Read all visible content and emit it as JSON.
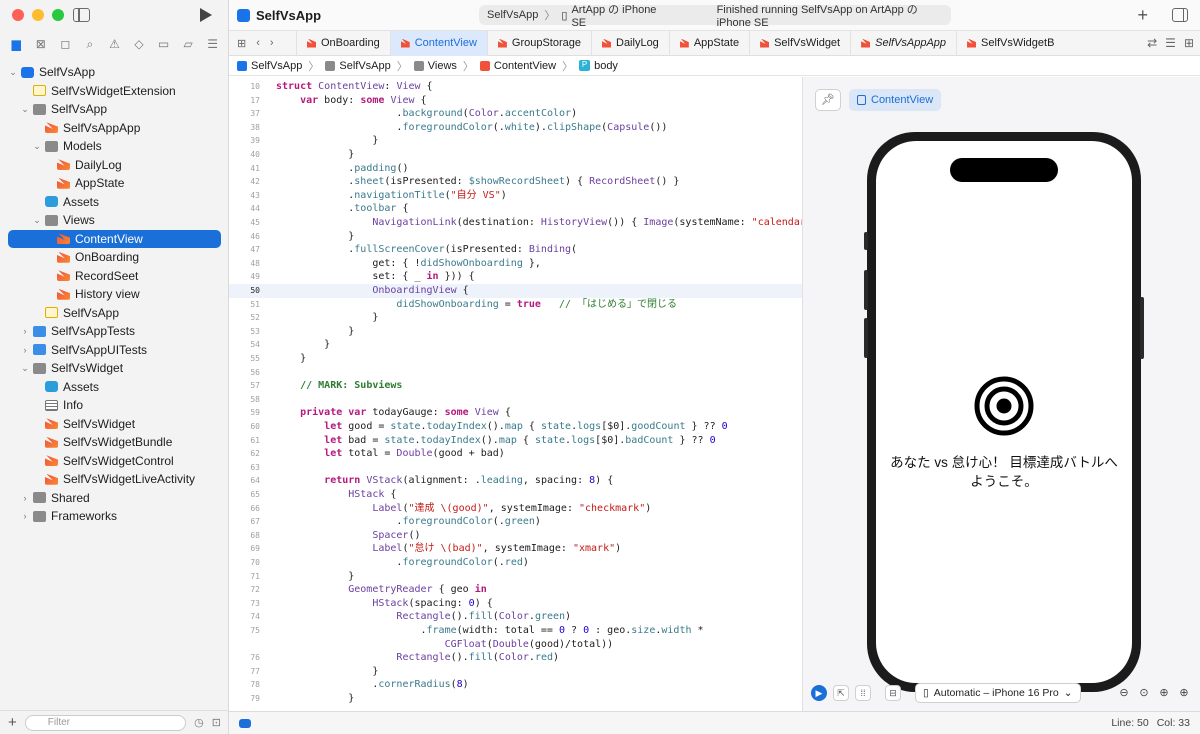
{
  "window": {
    "app_title": "SelfVsApp",
    "scheme": "SelfVsApp",
    "destination": "ArtApp の iPhone SE",
    "status": "Finished running SelfVsApp on ArtApp の iPhone SE"
  },
  "sidebar": {
    "items": [
      {
        "label": "SelfVsApp",
        "depth": 0,
        "icon": "app",
        "chevron": "down"
      },
      {
        "label": "SelfVsWidgetExtension",
        "depth": 1,
        "icon": "ext",
        "chevron": ""
      },
      {
        "label": "SelfVsApp",
        "depth": 1,
        "icon": "folder",
        "chevron": "down"
      },
      {
        "label": "SelfVsAppApp",
        "depth": 2,
        "icon": "swift",
        "chevron": ""
      },
      {
        "label": "Models",
        "depth": 2,
        "icon": "folder",
        "chevron": "down"
      },
      {
        "label": "DailyLog",
        "depth": 3,
        "icon": "swift",
        "chevron": ""
      },
      {
        "label": "AppState",
        "depth": 3,
        "icon": "swift",
        "chevron": ""
      },
      {
        "label": "Assets",
        "depth": 2,
        "icon": "assets",
        "chevron": ""
      },
      {
        "label": "Views",
        "depth": 2,
        "icon": "folder",
        "chevron": "down"
      },
      {
        "label": "ContentView",
        "depth": 3,
        "icon": "swift",
        "chevron": "",
        "selected": true
      },
      {
        "label": "OnBoarding",
        "depth": 3,
        "icon": "swift",
        "chevron": ""
      },
      {
        "label": "RecordSeet",
        "depth": 3,
        "icon": "swift",
        "chevron": ""
      },
      {
        "label": "History view",
        "depth": 3,
        "icon": "swift",
        "chevron": ""
      },
      {
        "label": "SelfVsApp",
        "depth": 2,
        "icon": "ext",
        "chevron": ""
      },
      {
        "label": "SelfVsAppTests",
        "depth": 1,
        "icon": "folder-blue",
        "chevron": "right"
      },
      {
        "label": "SelfVsAppUITests",
        "depth": 1,
        "icon": "folder-blue",
        "chevron": "right"
      },
      {
        "label": "SelfVsWidget",
        "depth": 1,
        "icon": "folder",
        "chevron": "down"
      },
      {
        "label": "Assets",
        "depth": 2,
        "icon": "assets",
        "chevron": ""
      },
      {
        "label": "Info",
        "depth": 2,
        "icon": "plist",
        "chevron": ""
      },
      {
        "label": "SelfVsWidget",
        "depth": 2,
        "icon": "swift",
        "chevron": ""
      },
      {
        "label": "SelfVsWidgetBundle",
        "depth": 2,
        "icon": "swift",
        "chevron": ""
      },
      {
        "label": "SelfVsWidgetControl",
        "depth": 2,
        "icon": "swift",
        "chevron": ""
      },
      {
        "label": "SelfVsWidgetLiveActivity",
        "depth": 2,
        "icon": "swift",
        "chevron": ""
      },
      {
        "label": "Shared",
        "depth": 1,
        "icon": "folder",
        "chevron": "right"
      },
      {
        "label": "Frameworks",
        "depth": 1,
        "icon": "folder",
        "chevron": "right"
      }
    ],
    "filter_placeholder": "Filter"
  },
  "tabs": [
    {
      "label": "OnBoarding",
      "active": false,
      "italic": false
    },
    {
      "label": "ContentView",
      "active": true,
      "italic": false
    },
    {
      "label": "GroupStorage",
      "active": false,
      "italic": false
    },
    {
      "label": "DailyLog",
      "active": false,
      "italic": false
    },
    {
      "label": "AppState",
      "active": false,
      "italic": false
    },
    {
      "label": "SelfVsWidget",
      "active": false,
      "italic": false
    },
    {
      "label": "SelfVsAppApp",
      "active": false,
      "italic": true
    },
    {
      "label": "SelfVsWidgetB",
      "active": false,
      "italic": false
    }
  ],
  "breadcrumb": [
    "SelfVsApp",
    "SelfVsApp",
    "Views",
    "ContentView",
    "body"
  ],
  "code": {
    "current_line": "50",
    "lines": [
      {
        "n": "10",
        "html": "<span class='kw'>struct</span> <span class='ty'>ContentView</span>: <span class='ty'>View</span> {"
      },
      {
        "n": "17",
        "html": "    <span class='kw'>var</span> body: <span class='kw'>some</span> <span class='ty'>View</span> {"
      },
      {
        "n": "37",
        "html": "                    .<span class='fn'>background</span>(<span class='ty'>Color</span>.<span class='fn'>accentColor</span>)"
      },
      {
        "n": "38",
        "html": "                    .<span class='fn'>foregroundColor</span>(.<span class='fn'>white</span>).<span class='fn'>clipShape</span>(<span class='ty'>Capsule</span>())"
      },
      {
        "n": "39",
        "html": "                }"
      },
      {
        "n": "40",
        "html": "            }"
      },
      {
        "n": "41",
        "html": "            .<span class='fn'>padding</span>()"
      },
      {
        "n": "42",
        "html": "            .<span class='fn'>sheet</span>(isPresented: <span class='fn'>$showRecordSheet</span>) { <span class='ty'>RecordSheet</span>() }"
      },
      {
        "n": "43",
        "html": "            .<span class='fn'>navigationTitle</span>(<span class='str'>\"自分 VS\"</span>)"
      },
      {
        "n": "44",
        "html": "            .<span class='fn'>toolbar</span> {"
      },
      {
        "n": "45",
        "html": "                <span class='ty'>NavigationLink</span>(destination: <span class='ty'>HistoryView</span>()) { <span class='ty'>Image</span>(systemName: <span class='str'>\"calendar\"</span>) }"
      },
      {
        "n": "46",
        "html": "            }"
      },
      {
        "n": "47",
        "html": "            .<span class='fn'>fullScreenCover</span>(isPresented: <span class='ty'>Binding</span>("
      },
      {
        "n": "48",
        "html": "                get: { !<span class='fn'>didShowOnboarding</span> },"
      },
      {
        "n": "49",
        "html": "                set: { _ <span class='kw'>in</span> })) {"
      },
      {
        "n": "50",
        "html": "                <span class='ty'>OnboardingView</span> {"
      },
      {
        "n": "51",
        "html": "                    <span class='fn'>didShowOnboarding</span> = <span class='kw'>true</span>   <span class='cm'>// 「はじめる」で閉じる</span>"
      },
      {
        "n": "52",
        "html": "                }"
      },
      {
        "n": "53",
        "html": "            }"
      },
      {
        "n": "54",
        "html": "        }"
      },
      {
        "n": "55",
        "html": "    }"
      },
      {
        "n": "56",
        "html": ""
      },
      {
        "n": "57",
        "html": "    <span class='mk'>// MARK: Subviews</span>"
      },
      {
        "n": "58",
        "html": ""
      },
      {
        "n": "59",
        "html": "    <span class='kw'>private</span> <span class='kw'>var</span> todayGauge: <span class='kw'>some</span> <span class='ty'>View</span> {"
      },
      {
        "n": "60",
        "html": "        <span class='kw'>let</span> good = <span class='fn'>state</span>.<span class='fn'>todayIndex</span>().<span class='fn'>map</span> { <span class='fn'>state</span>.<span class='fn'>logs</span>[$0].<span class='fn'>goodCount</span> } ?? <span class='num'>0</span>"
      },
      {
        "n": "61",
        "html": "        <span class='kw'>let</span> bad = <span class='fn'>state</span>.<span class='fn'>todayIndex</span>().<span class='fn'>map</span> { <span class='fn'>state</span>.<span class='fn'>logs</span>[$0].<span class='fn'>badCount</span> } ?? <span class='num'>0</span>"
      },
      {
        "n": "62",
        "html": "        <span class='kw'>let</span> total = <span class='ty'>Double</span>(good + bad)"
      },
      {
        "n": "63",
        "html": ""
      },
      {
        "n": "64",
        "html": "        <span class='kw'>return</span> <span class='ty'>VStack</span>(alignment: .<span class='fn'>leading</span>, spacing: <span class='num'>8</span>) {"
      },
      {
        "n": "65",
        "html": "            <span class='ty'>HStack</span> {"
      },
      {
        "n": "66",
        "html": "                <span class='ty'>Label</span>(<span class='str'>\"達成 \\(good)\"</span>, systemImage: <span class='str'>\"checkmark\"</span>)"
      },
      {
        "n": "67",
        "html": "                    .<span class='fn'>foregroundColor</span>(.<span class='fn'>green</span>)"
      },
      {
        "n": "68",
        "html": "                <span class='ty'>Spacer</span>()"
      },
      {
        "n": "69",
        "html": "                <span class='ty'>Label</span>(<span class='str'>\"怠け \\(bad)\"</span>, systemImage: <span class='str'>\"xmark\"</span>)"
      },
      {
        "n": "70",
        "html": "                    .<span class='fn'>foregroundColor</span>(.<span class='fn'>red</span>)"
      },
      {
        "n": "71",
        "html": "            }"
      },
      {
        "n": "72",
        "html": "            <span class='ty'>GeometryReader</span> { geo <span class='kw'>in</span>"
      },
      {
        "n": "73",
        "html": "                <span class='ty'>HStack</span>(spacing: <span class='num'>0</span>) {"
      },
      {
        "n": "74",
        "html": "                    <span class='ty'>Rectangle</span>().<span class='fn'>fill</span>(<span class='ty'>Color</span>.<span class='fn'>green</span>)"
      },
      {
        "n": "75",
        "html": "                        .<span class='fn'>frame</span>(width: total == <span class='num'>0</span> ? <span class='num'>0</span> : geo.<span class='fn'>size</span>.<span class='fn'>width</span> *"
      },
      {
        "n": "",
        "html": "                            <span class='ty'>CGFloat</span>(<span class='ty'>Double</span>(good)/total))"
      },
      {
        "n": "76",
        "html": "                    <span class='ty'>Rectangle</span>().<span class='fn'>fill</span>(<span class='ty'>Color</span>.<span class='fn'>red</span>)"
      },
      {
        "n": "77",
        "html": "                }"
      },
      {
        "n": "78",
        "html": "                .<span class='fn'>cornerRadius</span>(<span class='num'>8</span>)"
      },
      {
        "n": "79",
        "html": "            }"
      }
    ]
  },
  "preview": {
    "chip_label": "ContentView",
    "welcome_text": "あなた vs 怠け心！ 目標達成バトルへようこそ。",
    "device": "Automatic – iPhone 16 Pro"
  },
  "status": {
    "line": "Line: 50",
    "col": "Col: 33"
  },
  "colors": {
    "accent": "#1a6fd8",
    "selection": "#1a6fd8",
    "keyword": "#b5197d",
    "string": "#c41a16",
    "comment": "#2f7d32"
  }
}
